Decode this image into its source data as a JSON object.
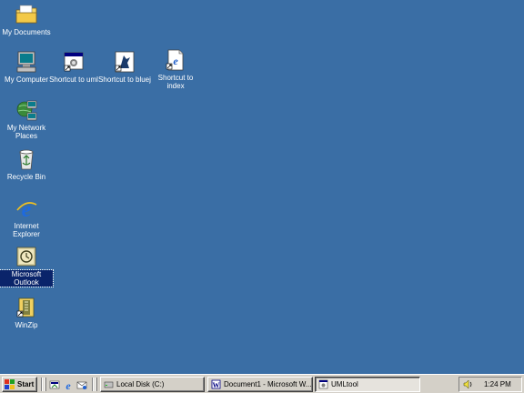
{
  "desktop": {
    "background_color": "#3a6ea5",
    "icons": [
      {
        "label": "My Documents",
        "icon": "folder-documents-icon"
      },
      {
        "label": "My Computer",
        "icon": "computer-icon"
      },
      {
        "label": "Shortcut to uml",
        "icon": "shortcut-uml-icon"
      },
      {
        "label": "Shortcut to bluej",
        "icon": "shortcut-bluej-icon"
      },
      {
        "label": "Shortcut to index",
        "icon": "shortcut-index-icon"
      },
      {
        "label": "My Network Places",
        "icon": "network-places-icon"
      },
      {
        "label": "Recycle Bin",
        "icon": "recycle-bin-icon"
      },
      {
        "label": "Internet Explorer",
        "icon": "internet-explorer-icon"
      },
      {
        "label": "Microsoft Outlook",
        "icon": "outlook-icon",
        "selected": true
      },
      {
        "label": "WinZip",
        "icon": "winzip-icon"
      }
    ]
  },
  "taskbar": {
    "start_label": "Start",
    "quick_launch": [
      "show-desktop-icon",
      "internet-explorer-icon",
      "outlook-express-icon"
    ],
    "tasks": [
      {
        "label": "Local Disk (C:)",
        "icon": "drive-icon",
        "active": false
      },
      {
        "label": "Document1 - Microsoft W...",
        "icon": "word-document-icon",
        "active": false
      },
      {
        "label": "UMLtool",
        "icon": "app-window-icon",
        "active": true
      }
    ],
    "tray": {
      "icons": [
        "volume-icon"
      ],
      "clock": "1:24 PM"
    }
  }
}
